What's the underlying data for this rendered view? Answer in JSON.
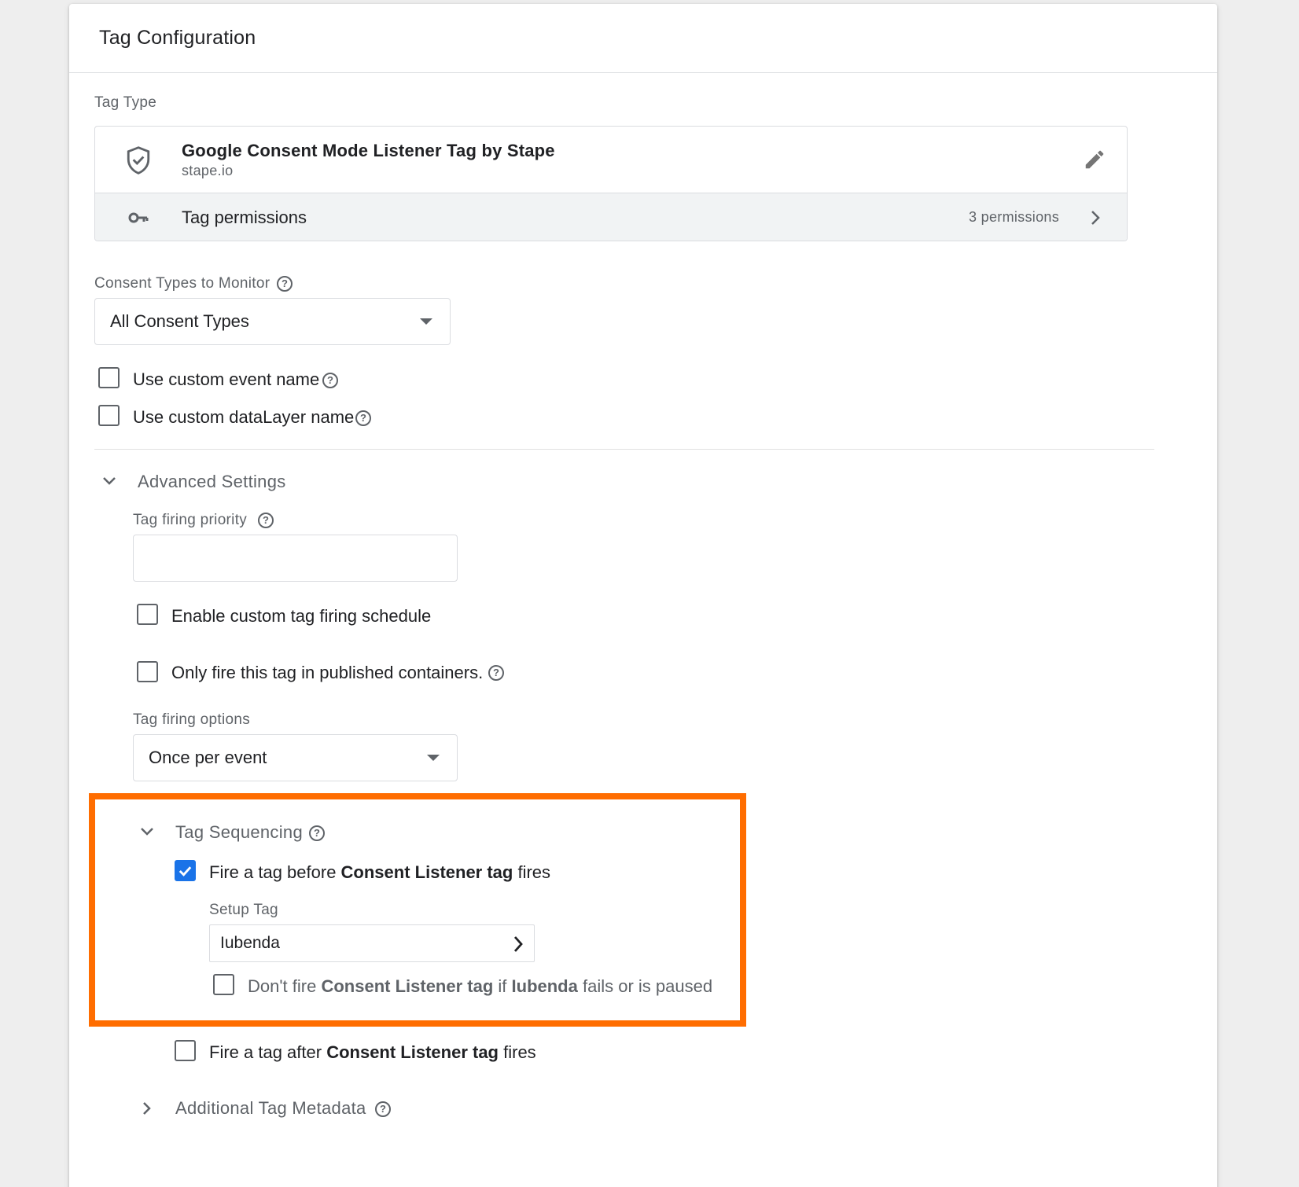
{
  "card": {
    "title": "Tag Configuration"
  },
  "tag_type": {
    "section_label": "Tag Type",
    "name": "Google Consent Mode Listener Tag by Stape",
    "vendor": "stape.io",
    "permissions_label": "Tag permissions",
    "permissions_count": "3 permissions",
    "icons": {
      "tag": "shield-check-icon",
      "edit": "pencil-icon",
      "permissions": "key-icon",
      "open": "chevron-right-icon"
    }
  },
  "consent_types": {
    "label": "Consent Types to Monitor",
    "value": "All Consent Types"
  },
  "options": {
    "custom_event_name": {
      "label": "Use custom event name",
      "checked": false
    },
    "custom_datalayer_name": {
      "label": "Use custom dataLayer name",
      "checked": false
    }
  },
  "advanced": {
    "title": "Advanced Settings",
    "firing_priority_label": "Tag firing priority",
    "firing_priority_value": "",
    "custom_schedule": {
      "label": "Enable custom tag firing schedule",
      "checked": false
    },
    "published_only": {
      "label": "Only fire this tag in published containers.",
      "checked": false
    },
    "firing_options_label": "Tag firing options",
    "firing_options_value": "Once per event"
  },
  "sequencing": {
    "title": "Tag Sequencing",
    "fire_before": {
      "prefix": "Fire a tag before ",
      "tag": "Consent Listener tag",
      "suffix": " fires",
      "checked": true
    },
    "setup_tag_label": "Setup Tag",
    "setup_tag_value": "Iubenda",
    "dont_fire": {
      "prefix": "Don't fire ",
      "tag": "Consent Listener tag",
      "middle": " if ",
      "setup": "Iubenda",
      "suffix": " fails or is paused",
      "checked": false
    },
    "fire_after": {
      "prefix": "Fire a tag after ",
      "tag": "Consent Listener tag",
      "suffix": " fires",
      "checked": false
    },
    "highlight_color": "#ff6d00"
  },
  "metadata": {
    "title": "Additional Tag Metadata"
  },
  "colors": {
    "accent": "#1a73e8",
    "highlight": "#ff6d00",
    "text": "#202124",
    "muted": "#5f6368"
  }
}
